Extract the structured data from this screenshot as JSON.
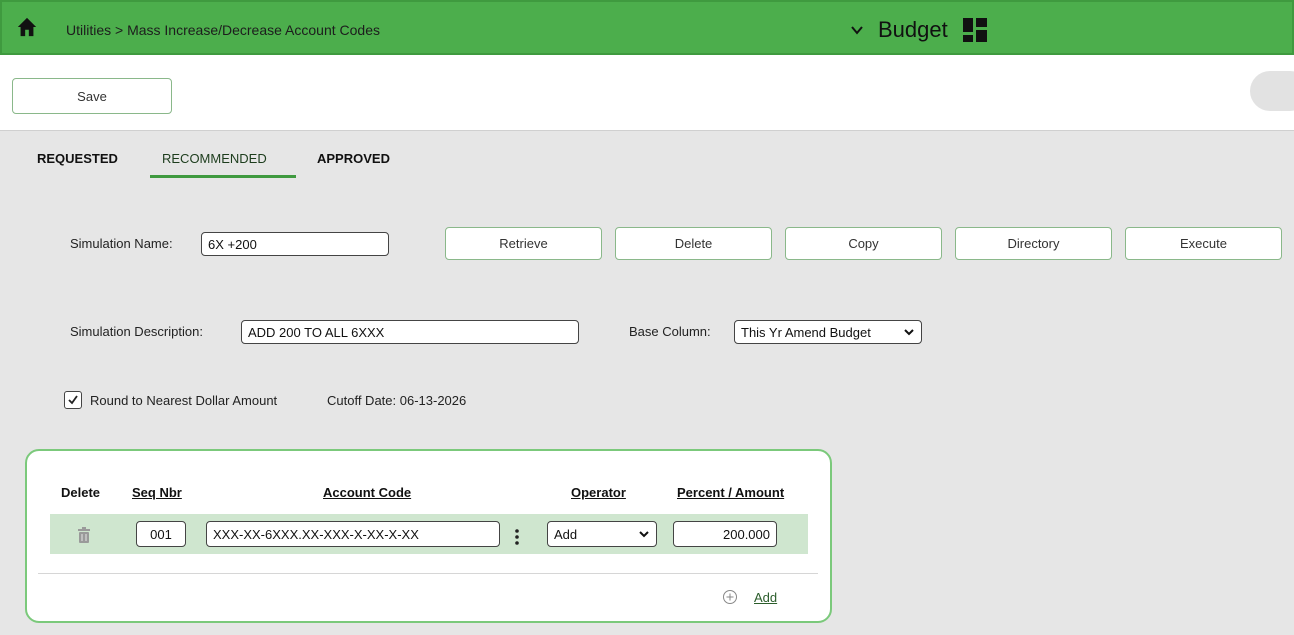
{
  "header": {
    "breadcrumb": "Utilities > Mass Increase/Decrease Account Codes",
    "module": "Budget"
  },
  "toolbar": {
    "save_label": "Save"
  },
  "tabs": [
    {
      "label": "REQUESTED"
    },
    {
      "label": "RECOMMENDED",
      "active": true
    },
    {
      "label": "APPROVED"
    }
  ],
  "form": {
    "simulation_name_label": "Simulation Name:",
    "simulation_name_value": "6X +200",
    "buttons": [
      "Retrieve",
      "Delete",
      "Copy",
      "Directory",
      "Execute"
    ],
    "simulation_description_label": "Simulation Description:",
    "simulation_description_value": "ADD 200 TO ALL 6XXX",
    "base_column_label": "Base Column:",
    "base_column_value": "This Yr Amend Budget",
    "round_label": "Round to Nearest Dollar Amount",
    "round_checked": true,
    "cutoff_date": "Cutoff Date: 06-13-2026"
  },
  "grid": {
    "headers": [
      "Delete",
      "Seq Nbr",
      "Account Code",
      "Operator",
      "Percent / Amount"
    ],
    "rows": [
      {
        "seq_nbr": "001",
        "account_code": "XXX-XX-6XXX.XX-XXX-X-XX-X-XX",
        "operator": "Add",
        "amount": "200.000"
      }
    ],
    "add_label": "Add"
  },
  "colors": {
    "header_green": "#4cae4c",
    "row_green": "#cfe6cf",
    "panel_border": "#7bc97b"
  },
  "icons": [
    "home-icon",
    "chevron-down-icon",
    "grid-icon",
    "trash-icon",
    "kebab-icon",
    "plus-circle-icon",
    "check-icon"
  ]
}
